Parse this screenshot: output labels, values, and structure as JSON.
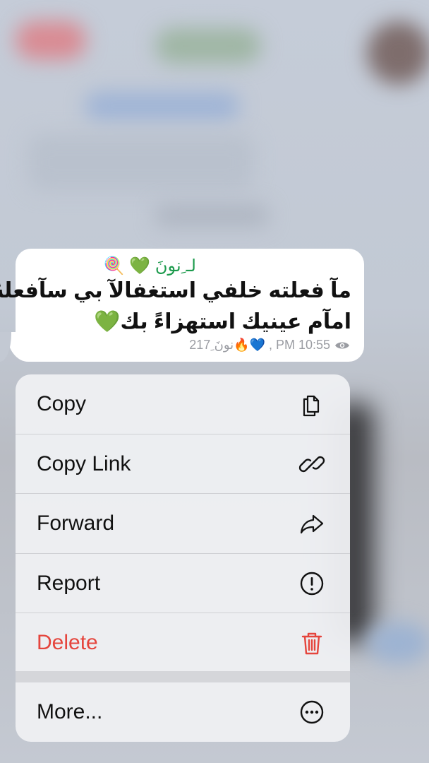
{
  "message": {
    "sender": "لـ ِنونَ 💚 🍭",
    "line1": "مآ فعلته خلفي استغفالآ بي سآفعلهُ",
    "line2": "امآم عينيك استهزاءً بك💚",
    "meta": "217 ِنونَ🔥💙 ,  PM 10:55"
  },
  "menu": {
    "items": [
      {
        "label": "Copy",
        "icon": "copy-icon"
      },
      {
        "label": "Copy Link",
        "icon": "link-icon"
      },
      {
        "label": "Forward",
        "icon": "forward-icon"
      },
      {
        "label": "Report",
        "icon": "report-icon"
      },
      {
        "label": "Delete",
        "icon": "trash-icon",
        "color": "#e5453d"
      },
      {
        "label": "More...",
        "icon": "more-icon"
      }
    ]
  }
}
